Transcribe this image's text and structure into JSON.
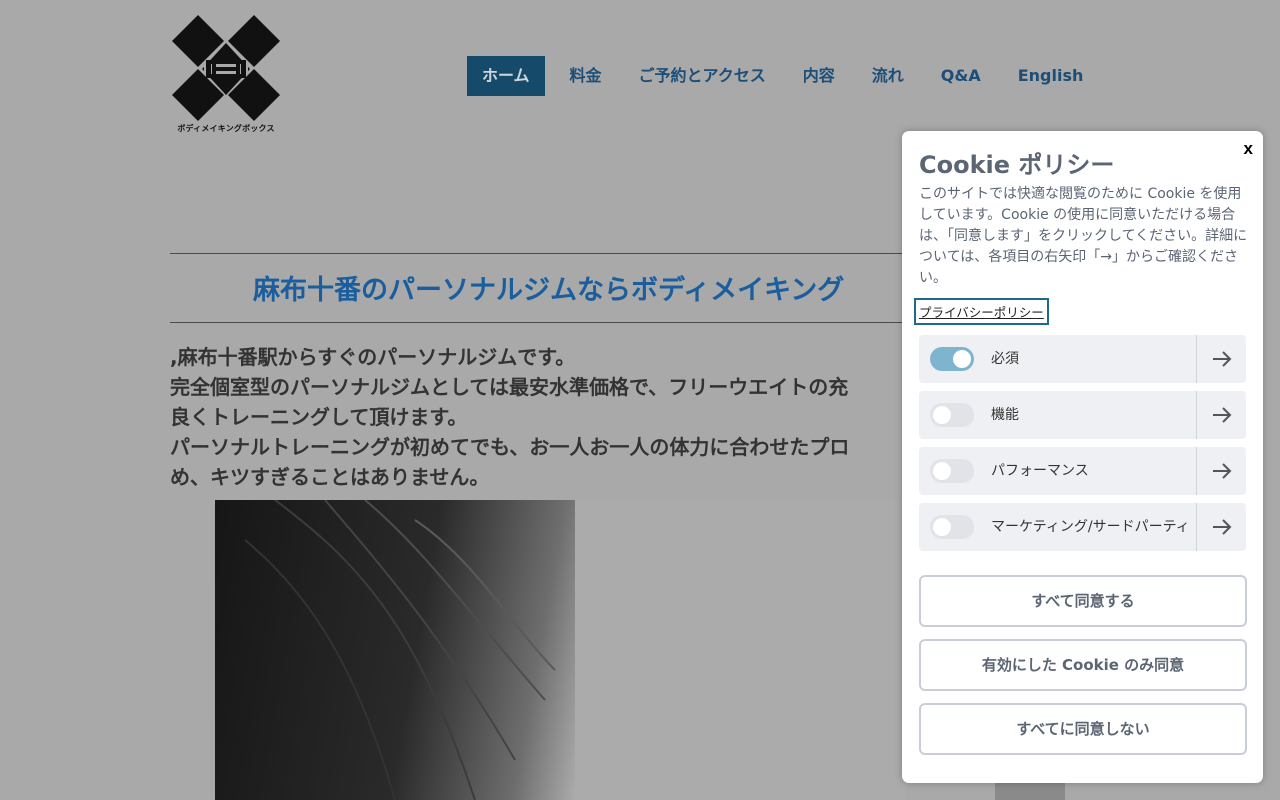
{
  "logo": {
    "text": "ボディメイキングボックス"
  },
  "nav": {
    "items": [
      {
        "label": "ホーム",
        "active": true
      },
      {
        "label": "料金"
      },
      {
        "label": "ご予約とアクセス"
      },
      {
        "label": "内容"
      },
      {
        "label": "流れ"
      },
      {
        "label": "Q&A"
      },
      {
        "label": "English"
      }
    ]
  },
  "main": {
    "headline": "麻布十番のパーソナルジムならボディメイキング",
    "paragraph_lines": [
      ",麻布十番駅からすぐのパーソナルジムです。",
      "完全個室型のパーソナルジムとしては最安水準価格で、フリーウエイトの充",
      "良くトレーニングして頂けます。",
      "パーソナルトレーニングが初めてでも、お一人お一人の体力に合わせたプロ",
      "め、キツすぎることはありません。"
    ]
  },
  "cookie": {
    "title": "Cookie ポリシー",
    "close": "x",
    "description": "このサイトでは快適な閲覧のために Cookie を使用しています。Cookie の使用に同意いただける場合は、「同意します」をクリックしてください。詳細については、各項目の右矢印「→」からご確認ください。",
    "privacy_link": "プライバシーポリシー",
    "categories": [
      {
        "label": "必須",
        "enabled": true
      },
      {
        "label": "機能",
        "enabled": false
      },
      {
        "label": "パフォーマンス",
        "enabled": false
      },
      {
        "label": "マーケティング/サードパーティ",
        "enabled": false
      }
    ],
    "buttons": {
      "accept_all": "すべて同意する",
      "accept_selected": "有効にした Cookie のみ同意",
      "reject_all": "すべてに同意しない"
    }
  },
  "colors": {
    "overlay_bg": "#a9a9a9",
    "nav_active_bg": "#164a6b",
    "headline": "#1a5e9e",
    "toggle_on": "#7fb4cf",
    "panel_text": "#5b6574"
  }
}
